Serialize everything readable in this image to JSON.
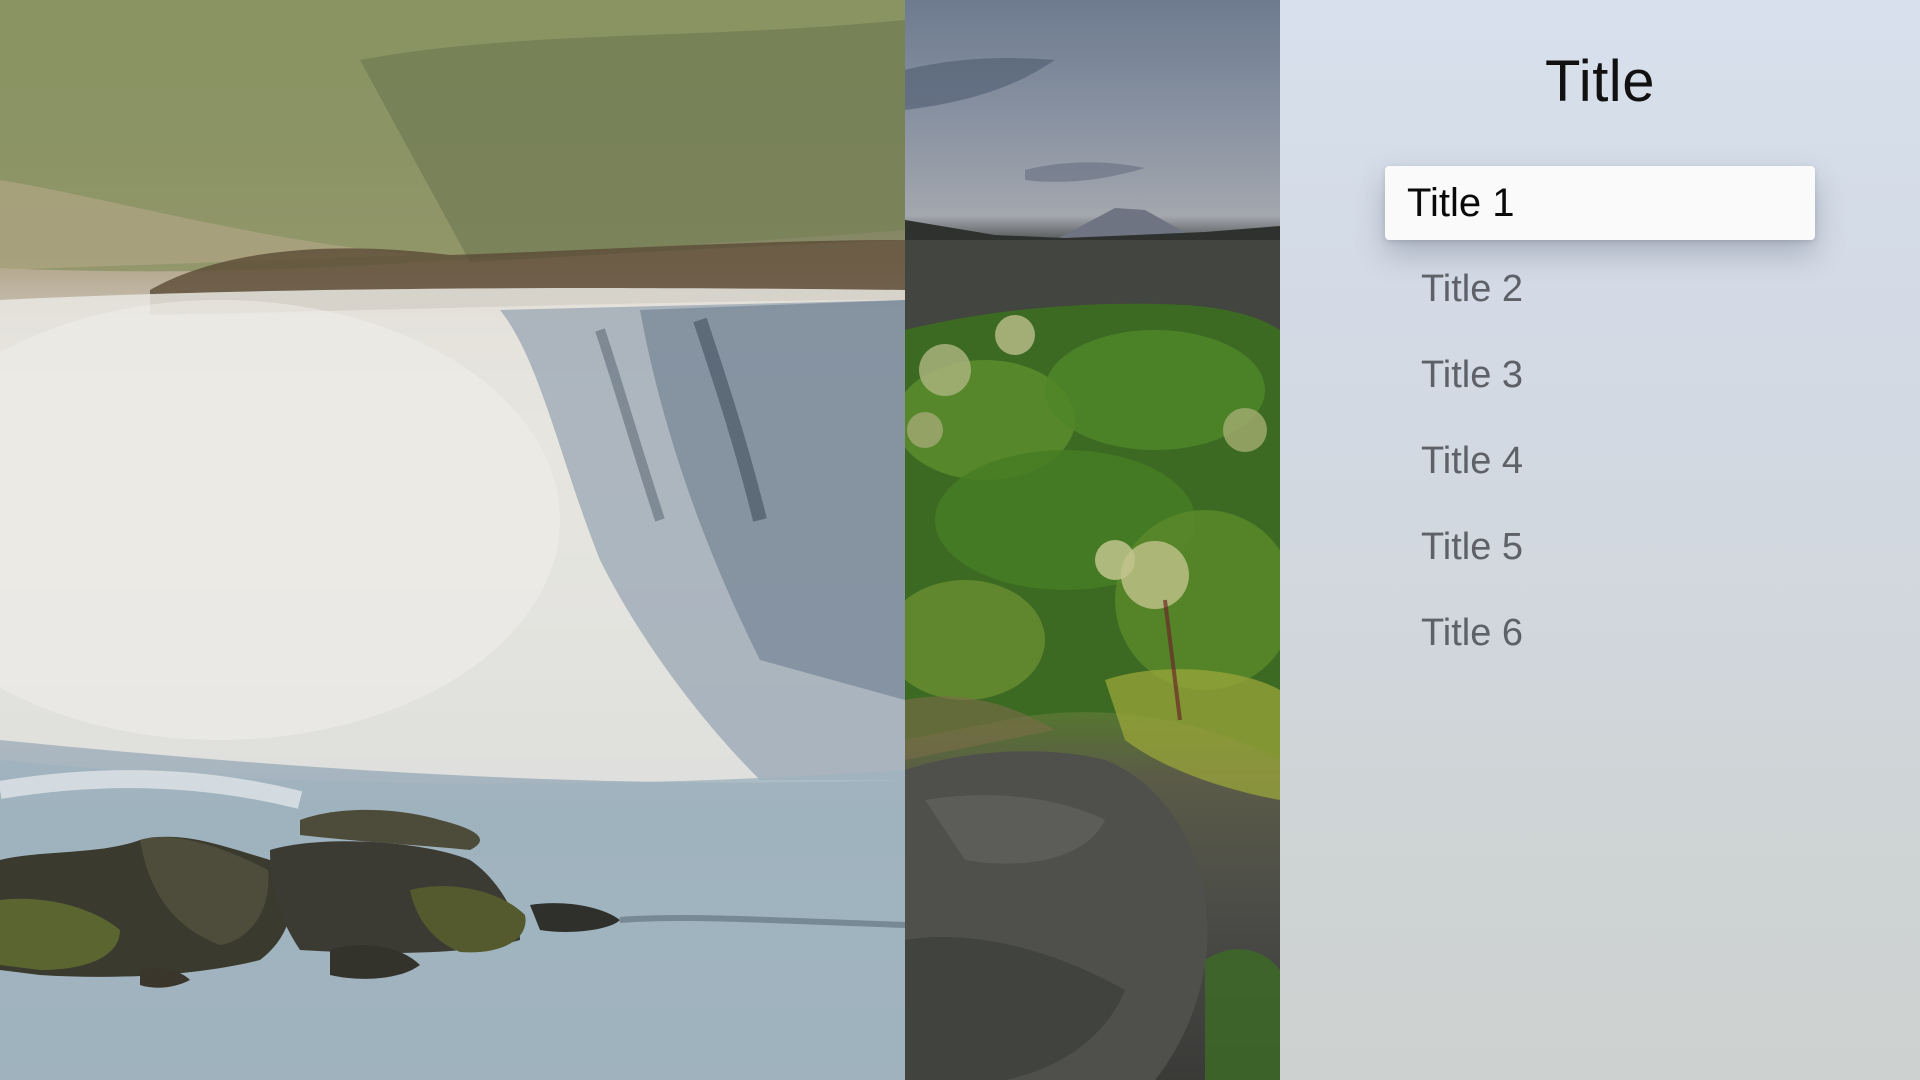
{
  "panel": {
    "title": "Title",
    "items": [
      {
        "label": "Title 1",
        "focused": true
      },
      {
        "label": "Title 2",
        "focused": false
      },
      {
        "label": "Title 3",
        "focused": false
      },
      {
        "label": "Title 4",
        "focused": false
      },
      {
        "label": "Title 5",
        "focused": false
      },
      {
        "label": "Title 6",
        "focused": false
      }
    ]
  },
  "images": [
    {
      "name": "waterfall-photo",
      "description": "waterfall landscape"
    },
    {
      "name": "plants-photo",
      "description": "green plants and rocks"
    }
  ]
}
